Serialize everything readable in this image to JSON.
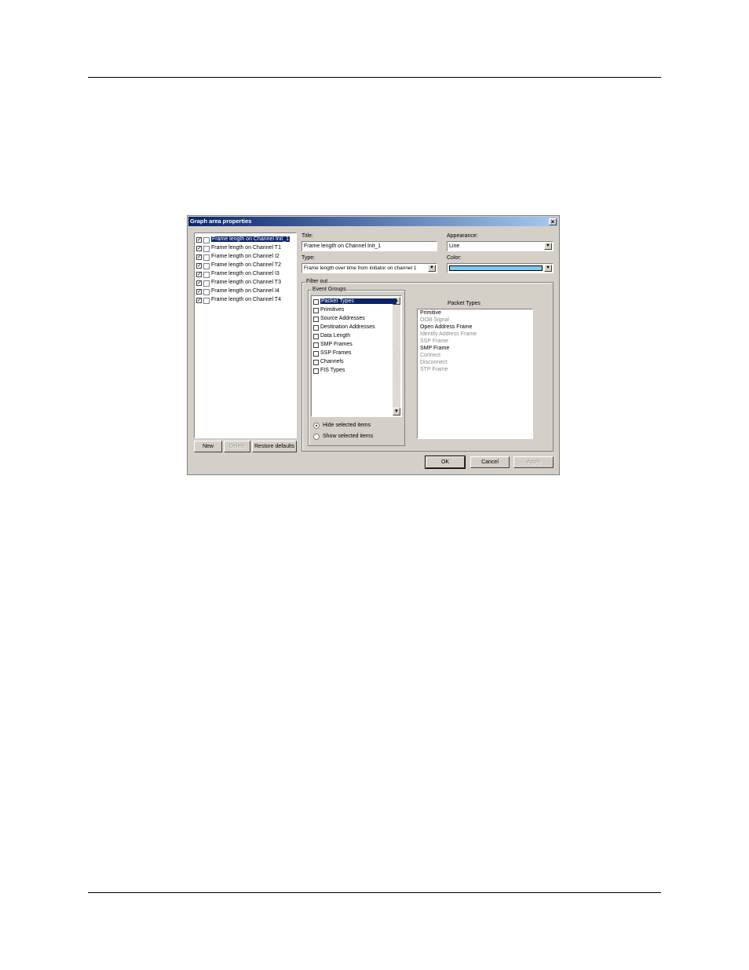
{
  "dialog": {
    "title": "Graph area properties",
    "close_glyph": "×"
  },
  "graph_list": {
    "items": [
      {
        "label": "Frame length on Channel Init_1",
        "checked": true,
        "selected": true
      },
      {
        "label": "Frame length on Channel T1",
        "checked": true,
        "selected": false
      },
      {
        "label": "Frame length on Channel I2",
        "checked": true,
        "selected": false
      },
      {
        "label": "Frame length on Channel T2",
        "checked": true,
        "selected": false
      },
      {
        "label": "Frame length on Channel I3",
        "checked": true,
        "selected": false
      },
      {
        "label": "Frame length on Channel T3",
        "checked": true,
        "selected": false
      },
      {
        "label": "Frame length on Channel I4",
        "checked": true,
        "selected": false
      },
      {
        "label": "Frame length on Channel T4",
        "checked": true,
        "selected": false
      }
    ],
    "new_label": "New",
    "delete_label": "Delete",
    "restore_label": "Restore defaults"
  },
  "fields": {
    "title_label": "Title:",
    "title_value": "Frame length on Channel Init_1",
    "appearance_label": "Appearance:",
    "appearance_value": "Line",
    "type_label": "Type:",
    "type_value": "Frame length over time from initiator on channel 1",
    "color_label": "Color:",
    "color_value": "#7ecbf0"
  },
  "filter": {
    "legend": "Filter out",
    "event_groups_legend": "Event Groups",
    "event_groups": [
      {
        "label": "Packet Types",
        "selected": true
      },
      {
        "label": "Primitives",
        "selected": false
      },
      {
        "label": "Source Addresses",
        "selected": false
      },
      {
        "label": "Destination Addresses",
        "selected": false
      },
      {
        "label": "Data Length",
        "selected": false
      },
      {
        "label": "SMP Frames",
        "selected": false
      },
      {
        "label": "SSP Frames",
        "selected": false
      },
      {
        "label": "Channels",
        "selected": false
      },
      {
        "label": "FIS Types",
        "selected": false
      }
    ],
    "hide_label": "Hide selected items",
    "show_label": "Show selected items",
    "mode": "hide",
    "packet_types_title": "Packet Types",
    "packet_types": [
      {
        "label": "Primitive",
        "enabled": true
      },
      {
        "label": "OOB Signal",
        "enabled": false
      },
      {
        "label": "Open Address Frame",
        "enabled": true
      },
      {
        "label": "Identify Address Frame",
        "enabled": false
      },
      {
        "label": "SSP Frame",
        "enabled": false
      },
      {
        "label": "SMP Frame",
        "enabled": true
      },
      {
        "label": "Connect",
        "enabled": false
      },
      {
        "label": "Disconnect",
        "enabled": false
      },
      {
        "label": "STP Frame",
        "enabled": false
      }
    ]
  },
  "footer": {
    "ok_label": "OK",
    "cancel_label": "Cancel",
    "apply_label": "Apply"
  }
}
